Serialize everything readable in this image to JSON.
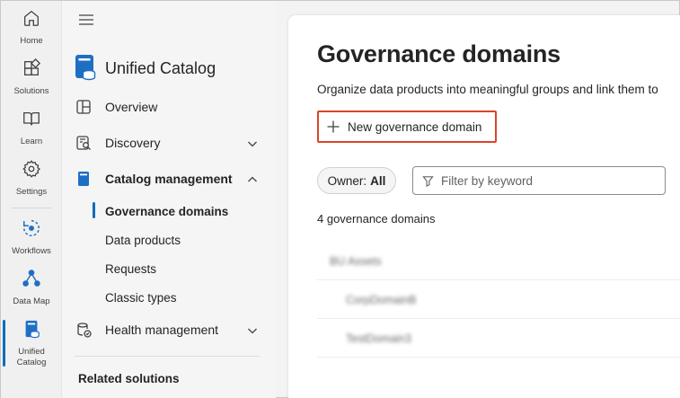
{
  "rail": {
    "items": [
      {
        "label": "Home",
        "icon": "home-icon"
      },
      {
        "label": "Solutions",
        "icon": "solutions-icon"
      },
      {
        "label": "Learn",
        "icon": "book-icon"
      },
      {
        "label": "Settings",
        "icon": "gear-icon"
      },
      {
        "label": "Workflows",
        "icon": "workflow-icon"
      },
      {
        "label": "Data Map",
        "icon": "data-map-icon"
      },
      {
        "label": "Unified Catalog",
        "icon": "catalog-icon"
      }
    ],
    "active": "Unified Catalog"
  },
  "nav": {
    "app_title": "Unified Catalog",
    "items": [
      {
        "label": "Overview",
        "icon": "overview-icon"
      },
      {
        "label": "Discovery",
        "icon": "discovery-icon",
        "expandable": true
      },
      {
        "label": "Catalog management",
        "icon": "catalog-management-icon",
        "expanded": true
      },
      {
        "label": "Health management",
        "icon": "health-management-icon",
        "expandable": true
      }
    ],
    "sub_items": [
      "Governance domains",
      "Data products",
      "Requests",
      "Classic types"
    ],
    "selected_sub_item": "Governance domains",
    "related_heading": "Related solutions"
  },
  "main": {
    "title": "Governance domains",
    "description": "Organize data products into meaningful groups and link them to",
    "new_button_label": "New governance domain",
    "owner_filter": {
      "label": "Owner:",
      "value": "All"
    },
    "filter_placeholder": "Filter by keyword",
    "count_text": "4 governance domains",
    "rows": [
      "BU Assets",
      "CorpDomainB",
      "TestDomain3"
    ]
  },
  "colors": {
    "accent": "#0f6cbd",
    "highlight_border": "#d9452b",
    "catalog_blue": "#1e6fc4"
  }
}
